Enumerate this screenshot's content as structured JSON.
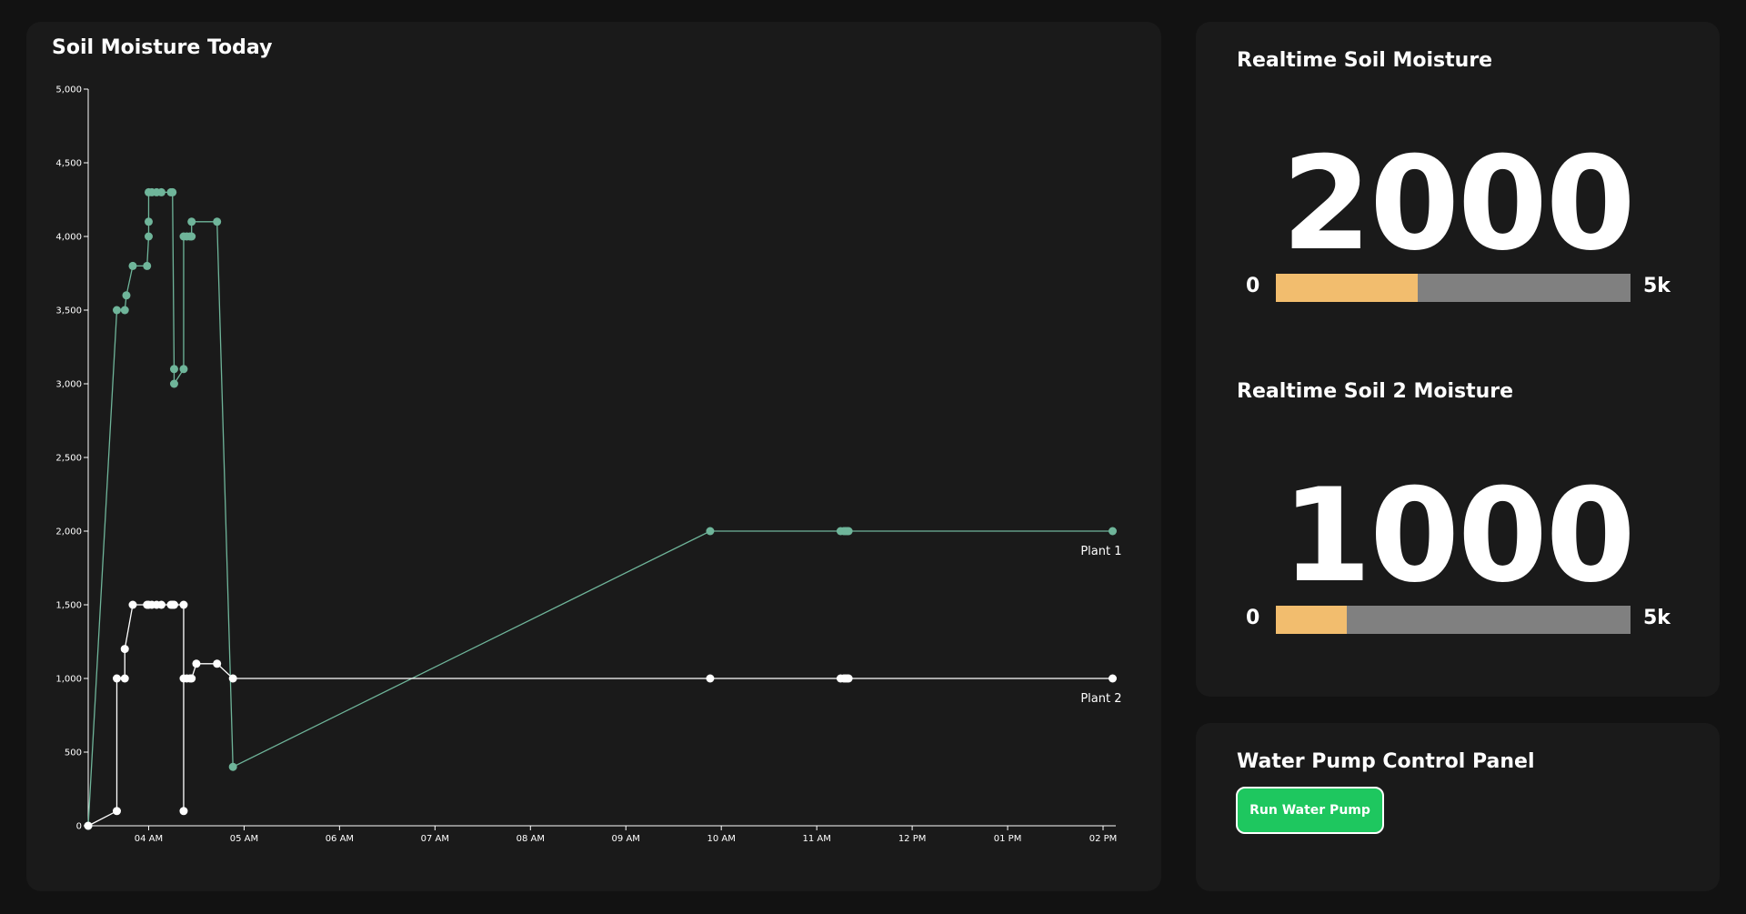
{
  "chart_card": {
    "title": "Soil Moisture Today"
  },
  "realtime": {
    "soil1": {
      "title": "Realtime Soil Moisture",
      "value": "2000",
      "min_label": "0",
      "max_label": "5k",
      "fill_fraction": 0.4
    },
    "soil2": {
      "title": "Realtime Soil 2 Moisture",
      "value": "1000",
      "min_label": "0",
      "max_label": "5k",
      "fill_fraction": 0.2
    }
  },
  "pump": {
    "title": "Water Pump Control Panel",
    "button_label": "Run Water Pump"
  },
  "colors": {
    "plant1": "#6fb59a",
    "plant2": "#ffffff",
    "bar_fill": "#f2bd6e",
    "bar_track": "#808080",
    "button_bg": "#1ec75f"
  },
  "chart_data": {
    "type": "line",
    "xlabel": "",
    "ylabel": "",
    "ylim": [
      0,
      5000
    ],
    "yticks": [
      0,
      500,
      1000,
      1500,
      2000,
      2500,
      3000,
      3500,
      4000,
      4500,
      5000
    ],
    "ytick_labels": [
      "0",
      "500",
      "1,000",
      "1,500",
      "2,000",
      "2,500",
      "3,000",
      "3,500",
      "4,000",
      "4,500",
      "5,000"
    ],
    "xlim": [
      "03:22",
      "14:08"
    ],
    "xticks": [
      "04:00",
      "05:00",
      "06:00",
      "07:00",
      "08:00",
      "09:00",
      "10:00",
      "11:00",
      "12:00",
      "13:00",
      "14:00"
    ],
    "xtick_labels": [
      "04 AM",
      "05 AM",
      "06 AM",
      "07 AM",
      "08 AM",
      "09 AM",
      "10 AM",
      "11 AM",
      "12 PM",
      "01 PM",
      "02 PM"
    ],
    "grid": false,
    "series": [
      {
        "name": "Plant 1",
        "points": [
          [
            "03:22",
            0
          ],
          [
            "03:40",
            3500
          ],
          [
            "03:45",
            3500
          ],
          [
            "03:46",
            3600
          ],
          [
            "03:50",
            3800
          ],
          [
            "03:59",
            3800
          ],
          [
            "04:00",
            4000
          ],
          [
            "04:00",
            4100
          ],
          [
            "04:00",
            4300
          ],
          [
            "04:02",
            4300
          ],
          [
            "04:05",
            4300
          ],
          [
            "04:08",
            4300
          ],
          [
            "04:14",
            4300
          ],
          [
            "04:15",
            4300
          ],
          [
            "04:16",
            3100
          ],
          [
            "04:16",
            3000
          ],
          [
            "04:22",
            3100
          ],
          [
            "04:22",
            4000
          ],
          [
            "04:24",
            4000
          ],
          [
            "04:26",
            4000
          ],
          [
            "04:27",
            4000
          ],
          [
            "04:27",
            4100
          ],
          [
            "04:43",
            4100
          ],
          [
            "04:53",
            400
          ],
          [
            "09:53",
            2000
          ],
          [
            "11:15",
            2000
          ],
          [
            "11:17",
            2000
          ],
          [
            "11:18",
            2000
          ],
          [
            "11:19",
            2000
          ],
          [
            "11:20",
            2000
          ],
          [
            "14:06",
            2000
          ]
        ]
      },
      {
        "name": "Plant 2",
        "points": [
          [
            "03:22",
            0
          ],
          [
            "03:40",
            100
          ],
          [
            "03:40",
            1000
          ],
          [
            "03:45",
            1000
          ],
          [
            "03:45",
            1200
          ],
          [
            "03:50",
            1500
          ],
          [
            "03:59",
            1500
          ],
          [
            "04:00",
            1500
          ],
          [
            "04:02",
            1500
          ],
          [
            "04:05",
            1500
          ],
          [
            "04:08",
            1500
          ],
          [
            "04:14",
            1500
          ],
          [
            "04:15",
            1500
          ],
          [
            "04:16",
            1500
          ],
          [
            "04:22",
            1500
          ],
          [
            "04:22",
            100
          ],
          [
            "04:22",
            1000
          ],
          [
            "04:24",
            1000
          ],
          [
            "04:26",
            1000
          ],
          [
            "04:27",
            1000
          ],
          [
            "04:30",
            1100
          ],
          [
            "04:43",
            1100
          ],
          [
            "04:53",
            1000
          ],
          [
            "09:53",
            1000
          ],
          [
            "11:15",
            1000
          ],
          [
            "11:17",
            1000
          ],
          [
            "11:18",
            1000
          ],
          [
            "11:19",
            1000
          ],
          [
            "11:20",
            1000
          ],
          [
            "14:06",
            1000
          ]
        ]
      }
    ]
  }
}
